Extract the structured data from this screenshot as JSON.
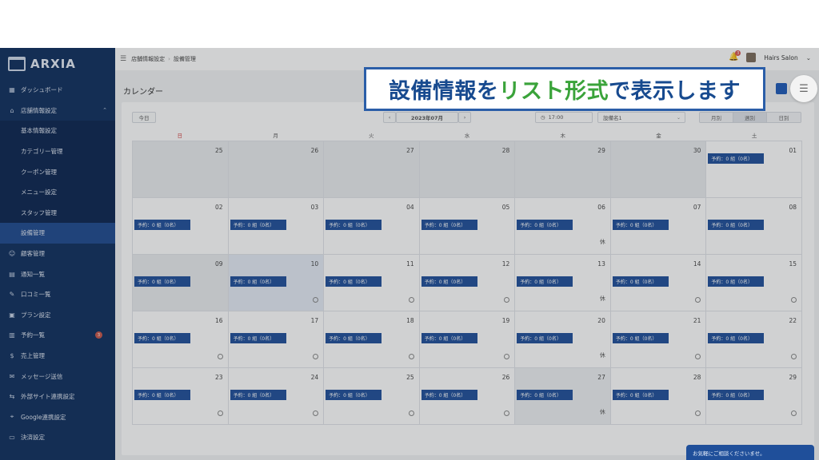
{
  "brand": {
    "logo_text": "ARXIA",
    "accent": "#1f4f9a",
    "sidebar_bg": "#0f2f5e"
  },
  "sidebar": {
    "items": [
      {
        "label": "ダッシュボード",
        "icon": "dashboard-icon"
      },
      {
        "label": "店舗情報設定",
        "icon": "store-icon",
        "expanded": true
      },
      {
        "label": "基本情報設定"
      },
      {
        "label": "カテゴリー管理"
      },
      {
        "label": "クーポン管理"
      },
      {
        "label": "メニュー設定"
      },
      {
        "label": "スタッフ管理"
      },
      {
        "label": "設備管理",
        "active": true
      },
      {
        "label": "顧客管理",
        "icon": "customers-icon"
      },
      {
        "label": "通知一覧",
        "icon": "notice-icon"
      },
      {
        "label": "口コミ一覧",
        "icon": "review-icon"
      },
      {
        "label": "プラン設定",
        "icon": "plan-icon"
      },
      {
        "label": "予約一覧",
        "icon": "reservation-icon",
        "badge": "3"
      },
      {
        "label": "売上管理",
        "icon": "sales-icon"
      },
      {
        "label": "メッセージ送信",
        "icon": "message-icon"
      },
      {
        "label": "外部サイト連携設定",
        "icon": "link-icon"
      },
      {
        "label": "Google連携設定",
        "icon": "location-icon"
      },
      {
        "label": "決済設定",
        "icon": "payment-icon"
      }
    ]
  },
  "topbar": {
    "breadcrumb": [
      "店舗情報設定",
      "設備管理"
    ],
    "notification_count": "3",
    "user_name": "Hairs Salon"
  },
  "page": {
    "title": "カレンダー"
  },
  "controls": {
    "today_label": "今日",
    "month_label": "2023年07月",
    "time_value": "17:00",
    "equipment_value": "設備名1",
    "view_tabs": [
      "月別",
      "週別",
      "日別"
    ],
    "active_view": "週別"
  },
  "calendar": {
    "weekdays": [
      "日",
      "月",
      "火",
      "水",
      "木",
      "金",
      "土"
    ],
    "reservation_label": "予約：0 組（0名）",
    "closed_label": "休",
    "weeks": [
      [
        {
          "d": "25",
          "out": true
        },
        {
          "d": "26",
          "out": true
        },
        {
          "d": "27",
          "out": true
        },
        {
          "d": "28",
          "out": true
        },
        {
          "d": "29",
          "out": true
        },
        {
          "d": "30",
          "out": true
        },
        {
          "d": "01",
          "resv": true
        }
      ],
      [
        {
          "d": "02",
          "resv": true
        },
        {
          "d": "03",
          "resv": true
        },
        {
          "d": "04",
          "resv": true
        },
        {
          "d": "05",
          "resv": true
        },
        {
          "d": "06",
          "resv": true,
          "mark": "休"
        },
        {
          "d": "07",
          "resv": true
        },
        {
          "d": "08",
          "resv": true
        }
      ],
      [
        {
          "d": "09",
          "resv": true,
          "out": true
        },
        {
          "d": "10",
          "resv": true,
          "today": true,
          "mark": "○"
        },
        {
          "d": "11",
          "resv": true,
          "mark": "○"
        },
        {
          "d": "12",
          "resv": true,
          "mark": "○"
        },
        {
          "d": "13",
          "resv": true,
          "mark": "休"
        },
        {
          "d": "14",
          "resv": true,
          "mark": "○"
        },
        {
          "d": "15",
          "resv": true,
          "mark": "○"
        }
      ],
      [
        {
          "d": "16",
          "resv": true,
          "mark": "○"
        },
        {
          "d": "17",
          "resv": true,
          "mark": "○"
        },
        {
          "d": "18",
          "resv": true,
          "mark": "○"
        },
        {
          "d": "19",
          "resv": true,
          "mark": "○"
        },
        {
          "d": "20",
          "resv": true,
          "mark": "休"
        },
        {
          "d": "21",
          "resv": true,
          "mark": "○"
        },
        {
          "d": "22",
          "resv": true,
          "mark": "○"
        }
      ],
      [
        {
          "d": "23",
          "resv": true,
          "mark": "○"
        },
        {
          "d": "24",
          "resv": true,
          "mark": "○"
        },
        {
          "d": "25",
          "resv": true,
          "mark": "○"
        },
        {
          "d": "26",
          "resv": true,
          "mark": "○"
        },
        {
          "d": "27",
          "resv": true,
          "mark": "休",
          "closed": true
        },
        {
          "d": "28",
          "resv": true,
          "mark": "○"
        },
        {
          "d": "29",
          "resv": true,
          "mark": "○"
        }
      ]
    ]
  },
  "callout": {
    "part1": "設備情報を",
    "highlight": "リスト形式",
    "part2": "で表示します"
  },
  "help_label": "お気軽にご相談くださいませ。"
}
